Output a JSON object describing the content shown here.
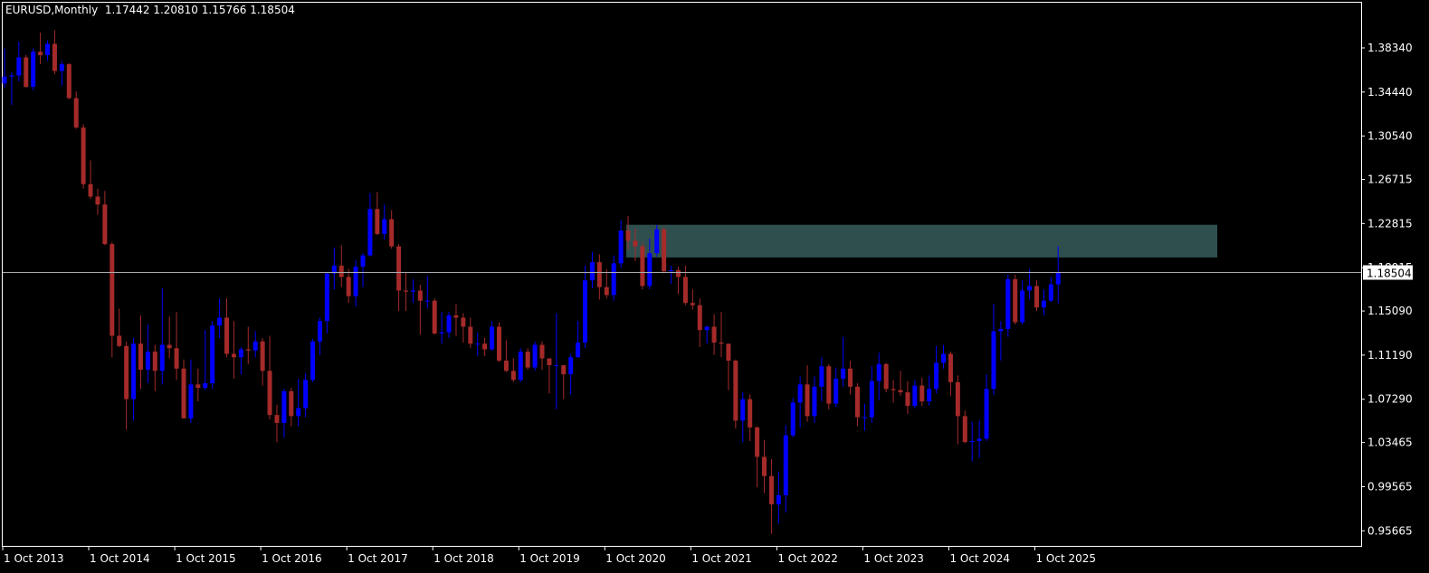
{
  "header": {
    "symbol_period": "EURUSD,Monthly",
    "open": "1.17442",
    "high": "1.20810",
    "low": "1.15766",
    "close": "1.18504"
  },
  "colors": {
    "bull": "#0000ff",
    "bear": "#a52a2a",
    "zone": "#2f4f4f",
    "bid_line": "#a9a9b0",
    "axis": "#ffffff",
    "background": "#000000"
  },
  "chart_data": {
    "type": "candlestick",
    "title": "EURUSD,Monthly",
    "first_bar": "Oct 2013",
    "first_open": 1.352,
    "bars_hlc": [
      [
        1.383,
        1.348,
        1.358
      ],
      [
        1.362,
        1.333,
        1.359
      ],
      [
        1.389,
        1.354,
        1.375
      ],
      [
        1.377,
        1.348,
        1.349
      ],
      [
        1.383,
        1.346,
        1.38
      ],
      [
        1.397,
        1.369,
        1.377
      ],
      [
        1.39,
        1.372,
        1.387
      ],
      [
        1.399,
        1.36,
        1.363
      ],
      [
        1.372,
        1.35,
        1.369
      ],
      [
        1.37,
        1.338,
        1.339
      ],
      [
        1.345,
        1.312,
        1.313
      ],
      [
        1.316,
        1.259,
        1.263
      ],
      [
        1.284,
        1.25,
        1.252
      ],
      [
        1.259,
        1.236,
        1.245
      ],
      [
        1.257,
        1.209,
        1.21
      ],
      [
        1.212,
        1.11,
        1.129
      ],
      [
        1.153,
        1.119,
        1.12
      ],
      [
        1.124,
        1.046,
        1.073
      ],
      [
        1.127,
        1.054,
        1.122
      ],
      [
        1.147,
        1.082,
        1.099
      ],
      [
        1.139,
        1.087,
        1.115
      ],
      [
        1.121,
        1.08,
        1.098
      ],
      [
        1.171,
        1.086,
        1.121
      ],
      [
        1.146,
        1.109,
        1.118
      ],
      [
        1.15,
        1.09,
        1.1
      ],
      [
        1.108,
        1.056,
        1.056
      ],
      [
        1.108,
        1.052,
        1.086
      ],
      [
        1.1,
        1.071,
        1.083
      ],
      [
        1.134,
        1.081,
        1.087
      ],
      [
        1.142,
        1.082,
        1.138
      ],
      [
        1.162,
        1.127,
        1.145
      ],
      [
        1.162,
        1.11,
        1.113
      ],
      [
        1.142,
        1.091,
        1.11
      ],
      [
        1.119,
        1.095,
        1.117
      ],
      [
        1.137,
        1.104,
        1.116
      ],
      [
        1.133,
        1.11,
        1.124
      ],
      [
        1.127,
        1.085,
        1.098
      ],
      [
        1.129,
        1.055,
        1.059
      ],
      [
        1.068,
        1.035,
        1.052
      ],
      [
        1.082,
        1.039,
        1.08
      ],
      [
        1.083,
        1.049,
        1.058
      ],
      [
        1.091,
        1.049,
        1.065
      ],
      [
        1.096,
        1.057,
        1.09
      ],
      [
        1.126,
        1.088,
        1.124
      ],
      [
        1.145,
        1.112,
        1.142
      ],
      [
        1.185,
        1.131,
        1.184
      ],
      [
        1.207,
        1.17,
        1.191
      ],
      [
        1.209,
        1.172,
        1.181
      ],
      [
        1.188,
        1.158,
        1.164
      ],
      [
        1.196,
        1.155,
        1.19
      ],
      [
        1.202,
        1.172,
        1.2
      ],
      [
        1.255,
        1.199,
        1.241
      ],
      [
        1.256,
        1.218,
        1.219
      ],
      [
        1.245,
        1.214,
        1.232
      ],
      [
        1.24,
        1.206,
        1.208
      ],
      [
        1.21,
        1.151,
        1.169
      ],
      [
        1.185,
        1.151,
        1.168
      ],
      [
        1.179,
        1.158,
        1.169
      ],
      [
        1.174,
        1.13,
        1.16
      ],
      [
        1.182,
        1.153,
        1.16
      ],
      [
        1.162,
        1.13,
        1.131
      ],
      [
        1.15,
        1.122,
        1.132
      ],
      [
        1.15,
        1.127,
        1.147
      ],
      [
        1.157,
        1.129,
        1.145
      ],
      [
        1.149,
        1.123,
        1.137
      ],
      [
        1.145,
        1.118,
        1.122
      ],
      [
        1.132,
        1.111,
        1.122
      ],
      [
        1.127,
        1.111,
        1.117
      ],
      [
        1.142,
        1.116,
        1.137
      ],
      [
        1.141,
        1.106,
        1.107
      ],
      [
        1.125,
        1.097,
        1.098
      ],
      [
        1.109,
        1.088,
        1.09
      ],
      [
        1.118,
        1.088,
        1.115
      ],
      [
        1.118,
        1.099,
        1.101
      ],
      [
        1.124,
        1.098,
        1.121
      ],
      [
        1.124,
        1.099,
        1.109
      ],
      [
        1.106,
        1.078,
        1.103
      ],
      [
        1.149,
        1.064,
        1.103
      ],
      [
        1.102,
        1.073,
        1.095
      ],
      [
        1.113,
        1.077,
        1.11
      ],
      [
        1.142,
        1.11,
        1.123
      ],
      [
        1.191,
        1.118,
        1.178
      ],
      [
        1.203,
        1.171,
        1.194
      ],
      [
        1.201,
        1.161,
        1.172
      ],
      [
        1.188,
        1.162,
        1.165
      ],
      [
        1.2,
        1.16,
        1.193
      ],
      [
        1.231,
        1.189,
        1.222
      ],
      [
        1.235,
        1.205,
        1.213
      ],
      [
        1.224,
        1.195,
        1.208
      ],
      [
        1.211,
        1.17,
        1.173
      ],
      [
        1.215,
        1.17,
        1.202
      ],
      [
        1.227,
        1.199,
        1.223
      ],
      [
        1.225,
        1.184,
        1.186
      ],
      [
        1.191,
        1.175,
        1.187
      ],
      [
        1.19,
        1.166,
        1.181
      ],
      [
        1.191,
        1.156,
        1.158
      ],
      [
        1.17,
        1.152,
        1.156
      ],
      [
        1.162,
        1.119,
        1.134
      ],
      [
        1.138,
        1.122,
        1.137
      ],
      [
        1.148,
        1.112,
        1.123
      ],
      [
        1.15,
        1.11,
        1.122
      ],
      [
        1.119,
        1.081,
        1.107
      ],
      [
        1.108,
        1.047,
        1.054
      ],
      [
        1.079,
        1.035,
        1.073
      ],
      [
        1.077,
        1.036,
        1.048
      ],
      [
        1.049,
        0.995,
        1.022
      ],
      [
        1.037,
        0.99,
        1.005
      ],
      [
        1.02,
        0.954,
        0.98
      ],
      [
        1.009,
        0.963,
        0.988
      ],
      [
        1.05,
        0.973,
        1.041
      ],
      [
        1.074,
        1.039,
        1.07
      ],
      [
        1.093,
        1.048,
        1.086
      ],
      [
        1.103,
        1.053,
        1.058
      ],
      [
        1.093,
        1.052,
        1.084
      ],
      [
        1.11,
        1.071,
        1.102
      ],
      [
        1.104,
        1.064,
        1.069
      ],
      [
        1.101,
        1.066,
        1.091
      ],
      [
        1.128,
        1.084,
        1.1
      ],
      [
        1.107,
        1.077,
        1.084
      ],
      [
        1.087,
        1.049,
        1.057
      ],
      [
        1.069,
        1.045,
        1.057
      ],
      [
        1.102,
        1.052,
        1.089
      ],
      [
        1.114,
        1.072,
        1.104
      ],
      [
        1.105,
        1.079,
        1.082
      ],
      [
        1.09,
        1.07,
        1.081
      ],
      [
        1.098,
        1.076,
        1.079
      ],
      [
        1.089,
        1.06,
        1.067
      ],
      [
        1.09,
        1.065,
        1.085
      ],
      [
        1.092,
        1.067,
        1.071
      ],
      [
        1.094,
        1.067,
        1.082
      ],
      [
        1.12,
        1.078,
        1.105
      ],
      [
        1.121,
        1.1,
        1.113
      ],
      [
        1.115,
        1.076,
        1.088
      ],
      [
        1.094,
        1.033,
        1.058
      ],
      [
        1.063,
        1.034,
        1.035
      ],
      [
        1.053,
        1.018,
        1.036
      ],
      [
        1.054,
        1.021,
        1.038
      ],
      [
        1.095,
        1.036,
        1.082
      ],
      [
        1.157,
        1.077,
        1.133
      ],
      [
        1.142,
        1.107,
        1.135
      ],
      [
        1.183,
        1.128,
        1.179
      ],
      [
        1.183,
        1.139,
        1.141
      ],
      [
        1.178,
        1.139,
        1.169
      ],
      [
        1.188,
        1.161,
        1.173
      ],
      [
        1.178,
        1.151,
        1.154
      ],
      [
        1.17,
        1.147,
        1.16
      ],
      [
        1.181,
        1.159,
        1.17442
      ],
      [
        1.2081,
        1.15766,
        1.18504
      ]
    ],
    "yticks": [
      "1.38340",
      "1.34440",
      "1.30540",
      "1.26715",
      "1.22815",
      "1.18915",
      "1.15090",
      "1.11190",
      "1.07290",
      "1.03465",
      "0.99565",
      "0.95665"
    ],
    "xticks": [
      "1 Oct 2013",
      "1 Oct 2014",
      "1 Oct 2015",
      "1 Oct 2016",
      "1 Oct 2017",
      "1 Oct 2018",
      "1 Oct 2019",
      "1 Oct 2020",
      "1 Oct 2021",
      "1 Oct 2022",
      "1 Oct 2023",
      "1 Oct 2024",
      "1 Oct 2025"
    ],
    "bid_price": "1.18504",
    "zone": {
      "from_bar": "Jan 2021",
      "top": 1.2271,
      "bottom": 1.1982
    }
  }
}
